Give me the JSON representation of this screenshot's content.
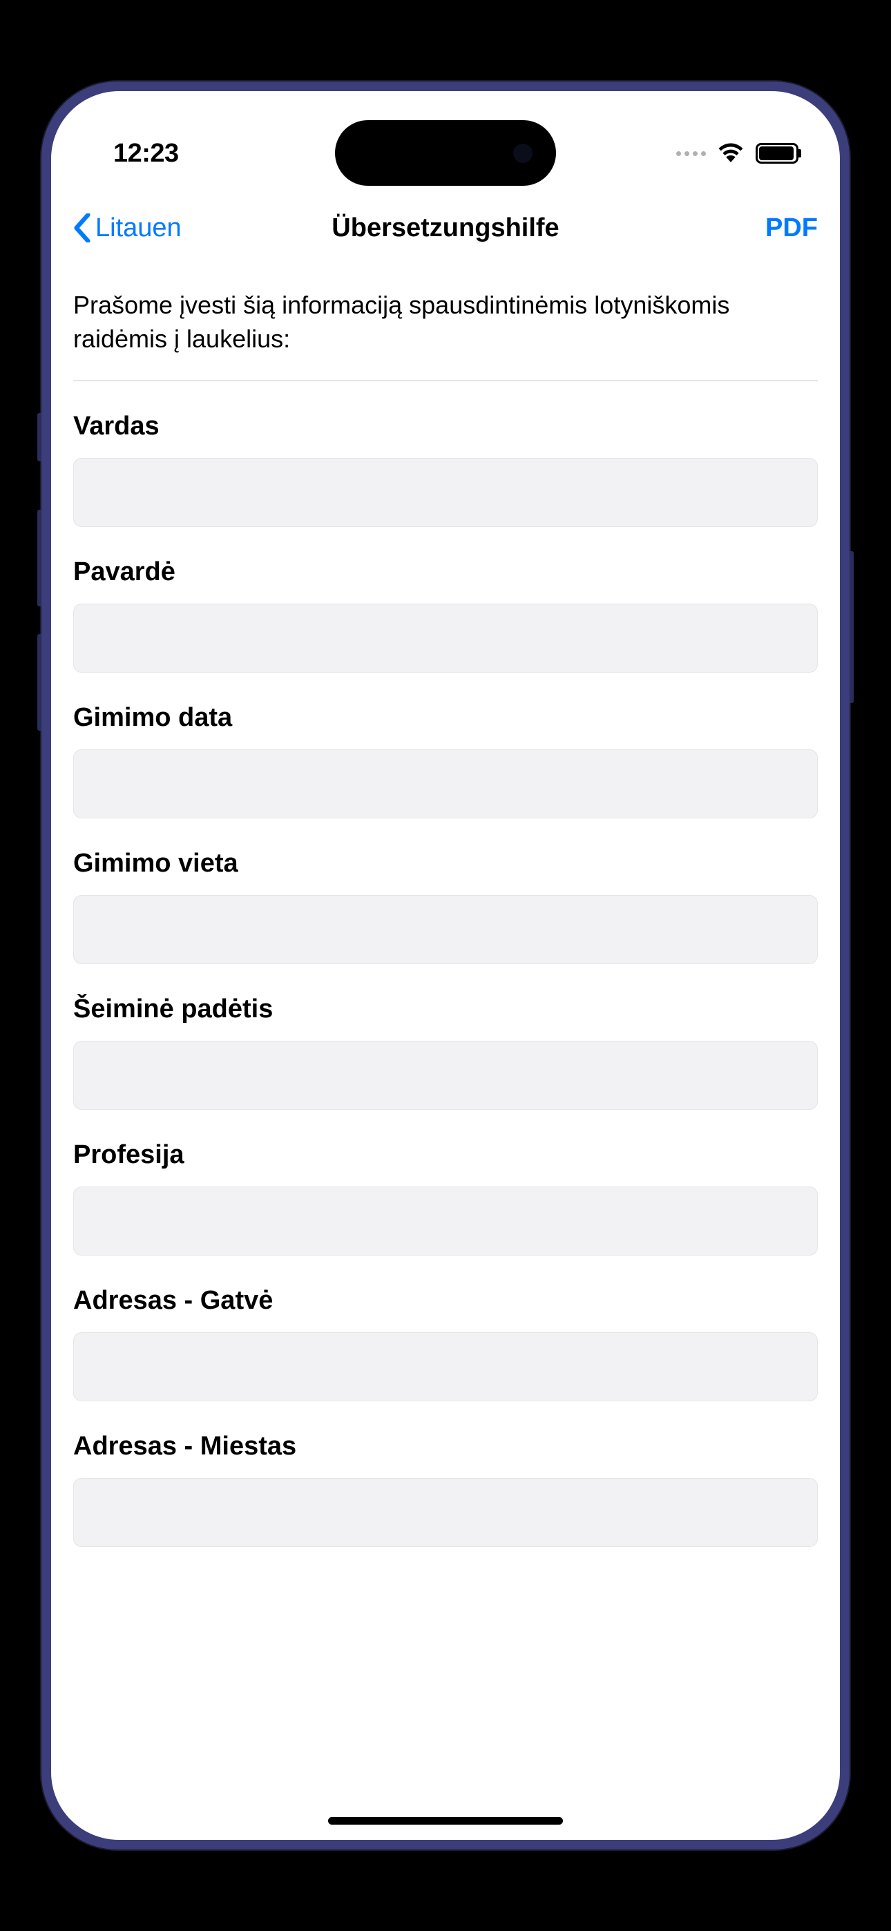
{
  "status_bar": {
    "time": "12:23"
  },
  "nav": {
    "back_label": "Litauen",
    "title": "Übersetzungshilfe",
    "action_label": "PDF"
  },
  "intro": "Prašome įvesti šią informaciją spausdintinėmis lotyniškomis raidėmis į laukelius:",
  "form": {
    "fields": [
      {
        "label": "Vardas",
        "value": ""
      },
      {
        "label": "Pavardė",
        "value": ""
      },
      {
        "label": "Gimimo data",
        "value": ""
      },
      {
        "label": "Gimimo vieta",
        "value": ""
      },
      {
        "label": "Šeiminė padėtis",
        "value": ""
      },
      {
        "label": "Profesija",
        "value": ""
      },
      {
        "label": "Adresas - Gatvė",
        "value": ""
      },
      {
        "label": "Adresas - Miestas",
        "value": ""
      }
    ]
  },
  "colors": {
    "accent": "#007aff",
    "input_bg": "#f2f2f4",
    "divider": "#c6c6c8"
  }
}
